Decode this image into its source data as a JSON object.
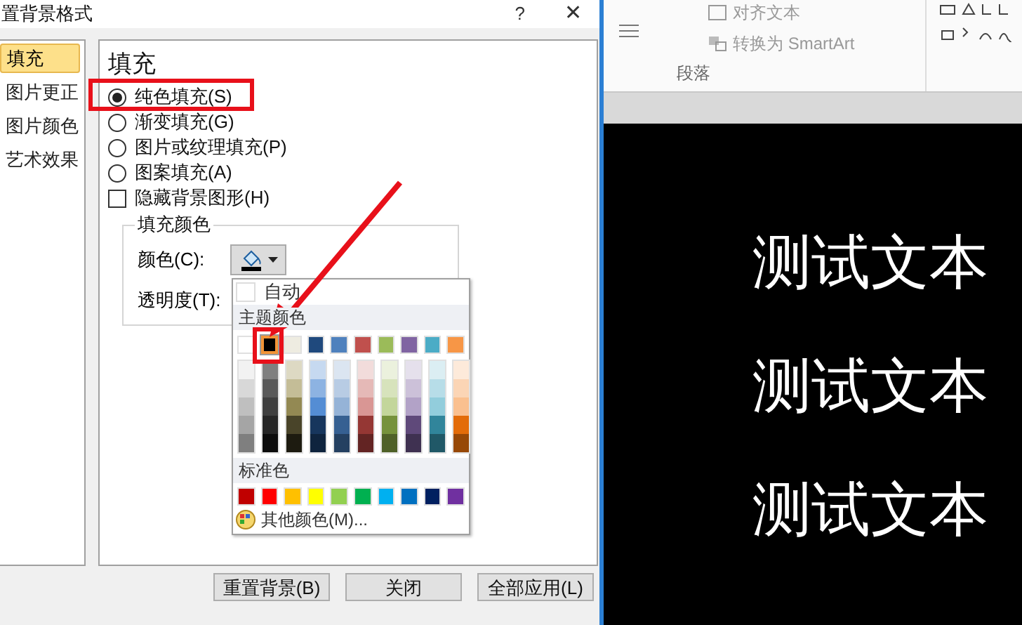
{
  "window": {
    "title": "置背景格式",
    "help": "?",
    "close": "✕"
  },
  "nav": [
    {
      "label": "填充",
      "selected": true
    },
    {
      "label": "图片更正",
      "selected": false
    },
    {
      "label": "图片颜色",
      "selected": false
    },
    {
      "label": "艺术效果",
      "selected": false
    }
  ],
  "panel": {
    "heading": "填充",
    "fill_options": [
      {
        "kind": "radio",
        "label": "纯色填充(S)",
        "selected": true
      },
      {
        "kind": "radio",
        "label": "渐变填充(G)",
        "selected": false
      },
      {
        "kind": "radio",
        "label": "图片或纹理填充(P)",
        "selected": false
      },
      {
        "kind": "radio",
        "label": "图案填充(A)",
        "selected": false
      },
      {
        "kind": "checkbox",
        "label": "隐藏背景图形(H)",
        "checked": false
      }
    ],
    "group_title": "填充颜色",
    "color_label": "颜色(C):",
    "color_button": {
      "color": "#000000"
    },
    "transparency_label": "透明度(T):"
  },
  "color_menu": {
    "auto_label": "自动",
    "theme_header": "主题颜色",
    "theme_colors": [
      {
        "color": "#ffffff",
        "selected": false,
        "shades": [
          {
            "color": "#f2f2f2"
          },
          {
            "color": "#d8d8d8"
          },
          {
            "color": "#bfbfbf"
          },
          {
            "color": "#a5a5a5"
          },
          {
            "color": "#7f7f7f"
          }
        ]
      },
      {
        "color": "#000000",
        "selected": true,
        "shades": [
          {
            "color": "#7f7f7f"
          },
          {
            "color": "#595959"
          },
          {
            "color": "#3f3f3f"
          },
          {
            "color": "#262626"
          },
          {
            "color": "#0c0c0c"
          }
        ]
      },
      {
        "color": "#eeece1",
        "selected": false,
        "shades": [
          {
            "color": "#ddd9c3"
          },
          {
            "color": "#c4bd97"
          },
          {
            "color": "#938953"
          },
          {
            "color": "#494429"
          },
          {
            "color": "#1d1b10"
          }
        ]
      },
      {
        "color": "#1f497d",
        "selected": false,
        "shades": [
          {
            "color": "#c6d9f0"
          },
          {
            "color": "#8db3e2"
          },
          {
            "color": "#548dd4"
          },
          {
            "color": "#17365d"
          },
          {
            "color": "#0f243e"
          }
        ]
      },
      {
        "color": "#4f81bd",
        "selected": false,
        "shades": [
          {
            "color": "#dbe5f1"
          },
          {
            "color": "#b8cce4"
          },
          {
            "color": "#95b3d7"
          },
          {
            "color": "#366092"
          },
          {
            "color": "#244061"
          }
        ]
      },
      {
        "color": "#c0504d",
        "selected": false,
        "shades": [
          {
            "color": "#f2dcdb"
          },
          {
            "color": "#e5b9b7"
          },
          {
            "color": "#d99694"
          },
          {
            "color": "#953734"
          },
          {
            "color": "#632423"
          }
        ]
      },
      {
        "color": "#9bbb59",
        "selected": false,
        "shades": [
          {
            "color": "#ebf1dd"
          },
          {
            "color": "#d7e3bc"
          },
          {
            "color": "#c3d69b"
          },
          {
            "color": "#76923c"
          },
          {
            "color": "#4f6128"
          }
        ]
      },
      {
        "color": "#8064a2",
        "selected": false,
        "shades": [
          {
            "color": "#e5e0ec"
          },
          {
            "color": "#ccc1d9"
          },
          {
            "color": "#b2a2c7"
          },
          {
            "color": "#5f497a"
          },
          {
            "color": "#3f3151"
          }
        ]
      },
      {
        "color": "#4bacc6",
        "selected": false,
        "shades": [
          {
            "color": "#dbeef3"
          },
          {
            "color": "#b7dde8"
          },
          {
            "color": "#92cddc"
          },
          {
            "color": "#31859b"
          },
          {
            "color": "#205867"
          }
        ]
      },
      {
        "color": "#f79646",
        "selected": false,
        "shades": [
          {
            "color": "#fdeada"
          },
          {
            "color": "#fbd5b5"
          },
          {
            "color": "#fac08f"
          },
          {
            "color": "#e36c09"
          },
          {
            "color": "#974806"
          }
        ]
      }
    ],
    "standard_header": "标准色",
    "standard_colors": [
      {
        "color": "#c00000"
      },
      {
        "color": "#ff0000"
      },
      {
        "color": "#ffc000"
      },
      {
        "color": "#ffff00"
      },
      {
        "color": "#92d050"
      },
      {
        "color": "#00b050"
      },
      {
        "color": "#00b0f0"
      },
      {
        "color": "#0070c0"
      },
      {
        "color": "#002060"
      },
      {
        "color": "#7030a0"
      }
    ],
    "more_label": "其他颜色(M)..."
  },
  "buttons": [
    "重置背景(B)",
    "关闭",
    "全部应用(L)"
  ],
  "ribbon": {
    "align_text": "对齐文本",
    "convert_smartart": "转换为 SmartArt",
    "group_label": "段落"
  },
  "slide": {
    "lines": [
      "测试文本",
      "测试文本",
      "测试文本"
    ]
  }
}
